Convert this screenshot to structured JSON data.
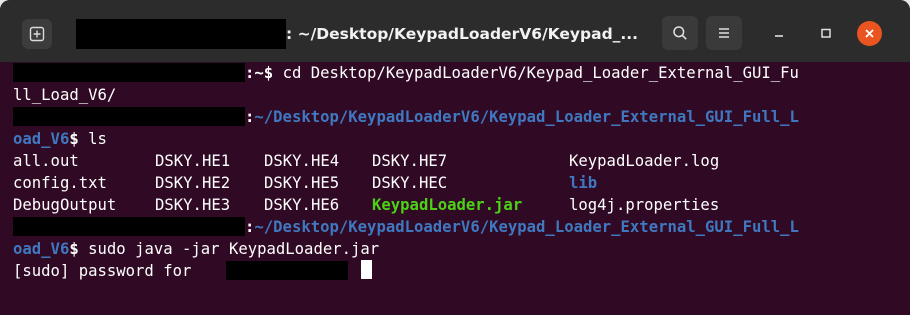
{
  "window": {
    "title": ": ~/Desktop/KeypadLoaderV6/Keypad_..."
  },
  "icons": {
    "new_tab": "new-tab-icon",
    "search": "search-icon",
    "menu": "hamburger-menu-icon",
    "minimize": "minimize-icon",
    "maximize": "maximize-icon",
    "close": "close-icon"
  },
  "colors": {
    "terminal_bg": "#300a24",
    "titlebar_bg": "#2c2c2c",
    "path_blue": "#3f78c0",
    "executable_green": "#4cd214",
    "close_orange": "#e95420"
  },
  "terminal": {
    "line1": {
      "prompt_suffix": ":~$ ",
      "command": "cd Desktop/KeypadLoaderV6/Keypad_Loader_External_GUI_Fu"
    },
    "line2": {
      "text": "ll_Load_V6/"
    },
    "line3": {
      "prompt_colon": ":",
      "path": "~/Desktop/KeypadLoaderV6/Keypad_Loader_External_GUI_Full_L"
    },
    "line4": {
      "path": "oad_V6",
      "dollar": "$ ",
      "command": "ls"
    },
    "ls_output": {
      "col1": [
        "all.out",
        "config.txt",
        "DebugOutput"
      ],
      "col2": [
        "DSKY.HE1",
        "DSKY.HE2",
        "DSKY.HE3"
      ],
      "col3": [
        "DSKY.HE4",
        "DSKY.HE5",
        "DSKY.HE6"
      ],
      "col4": [
        "DSKY.HE7",
        "DSKY.HEC",
        "KeypadLoader.jar"
      ],
      "col5": [
        "KeypadLoader.log",
        "lib",
        "log4j.properties"
      ]
    },
    "line8": {
      "prompt_colon": ":",
      "path": "~/Desktop/KeypadLoaderV6/Keypad_Loader_External_GUI_Full_L"
    },
    "line9": {
      "path": "oad_V6",
      "dollar": "$ ",
      "command": "sudo java -jar KeypadLoader.jar"
    },
    "line10": {
      "text": "[sudo] password for "
    }
  }
}
